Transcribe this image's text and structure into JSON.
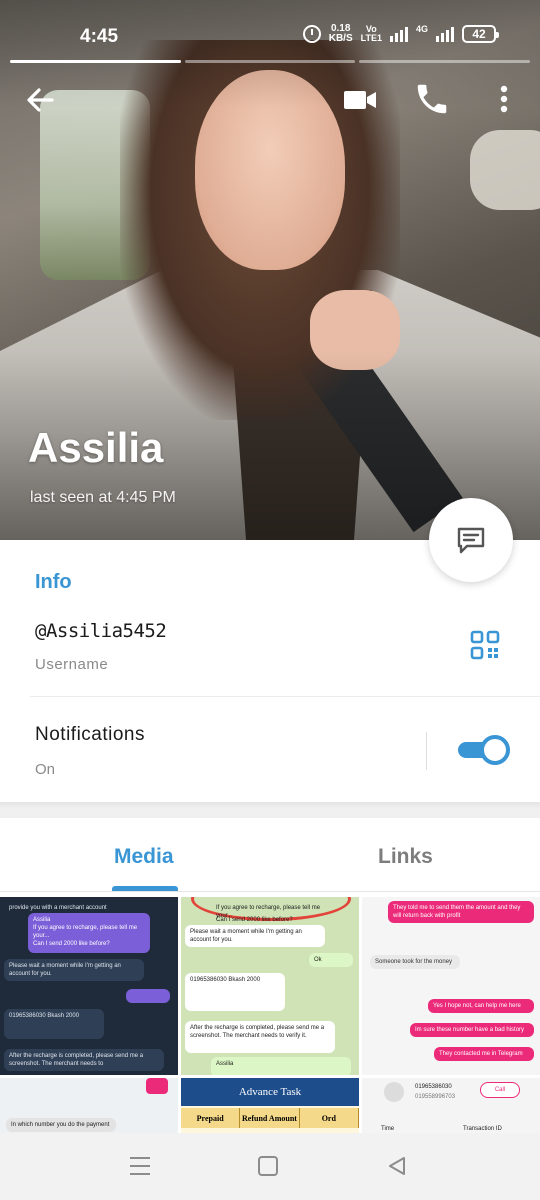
{
  "status_bar": {
    "time": "4:45",
    "net_speed": "0.18",
    "net_speed_unit": "KB/S",
    "volte_top": "Vo",
    "volte_bottom": "LTE1",
    "net_type": "4G",
    "battery": "42"
  },
  "header": {
    "name": "Assilia",
    "last_seen": "last seen at 4:45 PM",
    "icons": [
      "back-arrow-icon",
      "video-camera-icon",
      "phone-icon",
      "more-vertical-icon",
      "message-icon"
    ]
  },
  "info": {
    "title": "Info",
    "username": "@Assilia5452",
    "username_caption": "Username",
    "notifications_label": "Notifications",
    "notifications_status": "On",
    "notifications_enabled": true
  },
  "tabs": {
    "items": [
      {
        "label": "Media",
        "active": true
      },
      {
        "label": "Links",
        "active": false
      }
    ]
  },
  "media": {
    "tile1": {
      "line1": "provide you with a merchant account",
      "reply_name": "Assilia",
      "reply_text": "If you agree to recharge, please tell me your...",
      "msg_out": "Can I send 2000 like before?",
      "msg_in1": "Please wait a moment while I'm getting an account for you.",
      "msg_in2": "01965386030 Bkash 2000",
      "msg_in3": "After the recharge is completed, please send me a screenshot. The merchant needs to"
    },
    "tile2": {
      "reply_text": "If you agree to recharge, please tell me your...",
      "msg_out": "Can I send 2000 like before?",
      "msg_in1": "Please wait a moment while I'm getting an account for you.",
      "msg_ok": "Ok",
      "msg_in2": "01965386030 Bkash 2000",
      "msg_in3": "After the recharge is completed, please send me a screenshot. The merchant needs to verify it.",
      "reply_name": "Assilia"
    },
    "tile3": {
      "msg_out1": "They told me to send them the amount and they will return back with profit",
      "msg_in1": "Someone took for the money",
      "msg_out2": "Yes I hope not, can help me here",
      "msg_out3": "Im sure these number have a bad history",
      "msg_out4": "They contacted me in Telegram"
    },
    "tile4": {
      "text": "In which number you do the payment"
    },
    "tile5": {
      "title": "Advance Task",
      "col1": "Prepaid",
      "col2": "Refund Amount",
      "col3": "Ord"
    },
    "tile6": {
      "number1": "01965386030",
      "number2": "019558996703",
      "call_label": "Call",
      "col1": "Time",
      "col2": "Transaction ID"
    }
  },
  "colors": {
    "accent": "#3a95d5",
    "text_primary": "#1b1b1b",
    "text_secondary": "#8a8a8a"
  }
}
